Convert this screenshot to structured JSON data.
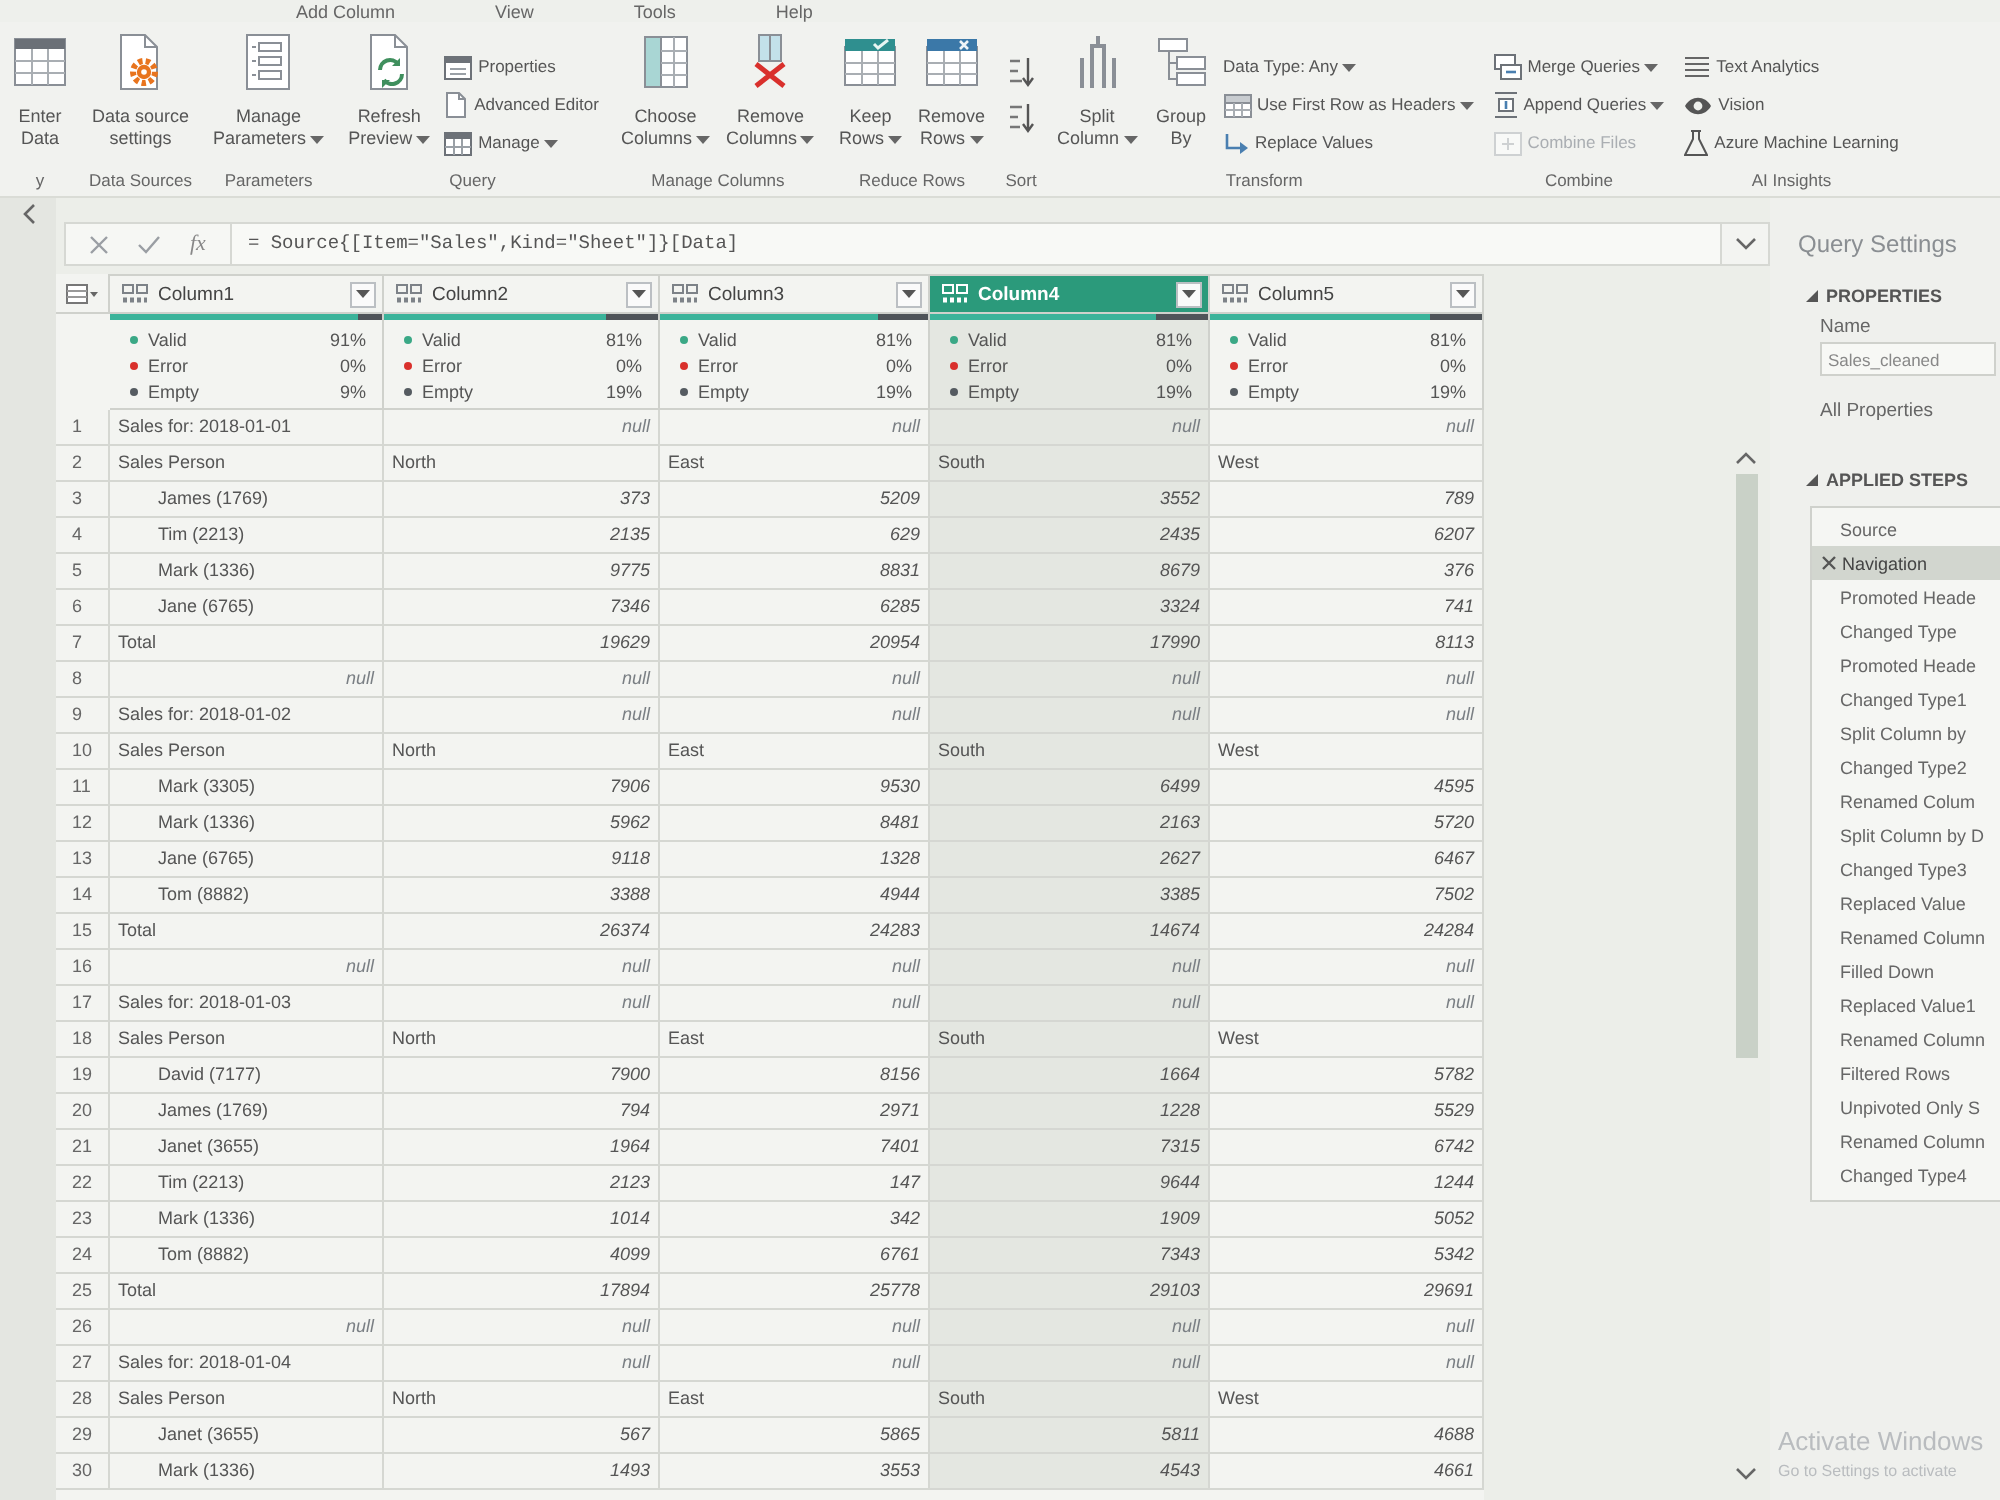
{
  "menu_tabs": [
    {
      "label": "Add Column",
      "selected": false
    },
    {
      "label": "View",
      "selected": false
    },
    {
      "label": "Tools",
      "selected": false
    },
    {
      "label": "Help",
      "selected": false
    }
  ],
  "ribbon": [
    {
      "label": "y",
      "items": [
        {
          "kind": "large",
          "lines": [
            "Enter",
            "Data"
          ],
          "dropdown": false,
          "disabled": false
        }
      ]
    },
    {
      "label": "Data Sources",
      "items": [
        {
          "kind": "large",
          "lines": [
            "Data source",
            "settings"
          ],
          "dropdown": false,
          "disabled": false
        }
      ]
    },
    {
      "label": "Parameters",
      "items": [
        {
          "kind": "large",
          "lines": [
            "Manage",
            "Parameters"
          ],
          "dropdown": true,
          "disabled": false
        }
      ]
    },
    {
      "label": "Query",
      "items": [
        {
          "kind": "large",
          "lines": [
            "Refresh",
            "Preview"
          ],
          "dropdown": true,
          "disabled": false
        },
        {
          "kind": "small",
          "lines": [
            "Properties"
          ],
          "dropdown": false,
          "disabled": false
        },
        {
          "kind": "small",
          "lines": [
            "Advanced Editor"
          ],
          "dropdown": false,
          "disabled": false
        },
        {
          "kind": "small",
          "lines": [
            "Manage"
          ],
          "dropdown": true,
          "disabled": false
        }
      ]
    },
    {
      "label": "Manage Columns",
      "items": [
        {
          "kind": "large",
          "lines": [
            "Choose",
            "Columns"
          ],
          "dropdown": true,
          "disabled": false
        },
        {
          "kind": "large",
          "lines": [
            "Remove",
            "Columns"
          ],
          "dropdown": true,
          "disabled": false
        }
      ]
    },
    {
      "label": "Reduce Rows",
      "items": [
        {
          "kind": "large",
          "lines": [
            "Keep",
            "Rows"
          ],
          "dropdown": true,
          "disabled": false
        },
        {
          "kind": "large",
          "lines": [
            "Remove",
            "Rows"
          ],
          "dropdown": true,
          "disabled": false
        }
      ]
    },
    {
      "label": "Sort",
      "items": [
        {
          "kind": "icon",
          "dropdown": false,
          "disabled": false
        },
        {
          "kind": "icon",
          "dropdown": false,
          "disabled": false
        }
      ]
    },
    {
      "label": "Transform",
      "items": [
        {
          "kind": "large",
          "lines": [
            "Split",
            "Column"
          ],
          "dropdown": true,
          "disabled": false
        },
        {
          "kind": "large",
          "lines": [
            "Group",
            "By"
          ],
          "dropdown": false,
          "disabled": false
        },
        {
          "kind": "plain",
          "lines": [
            "Data Type: Any"
          ],
          "dropdown": true,
          "disabled": false
        },
        {
          "kind": "small",
          "lines": [
            "Use First Row as Headers"
          ],
          "dropdown": true,
          "disabled": false
        },
        {
          "kind": "small",
          "lines": [
            "Replace Values"
          ],
          "dropdown": false,
          "disabled": false
        }
      ]
    },
    {
      "label": "Combine",
      "items": [
        {
          "kind": "small",
          "lines": [
            "Merge Queries"
          ],
          "dropdown": true,
          "disabled": false
        },
        {
          "kind": "small",
          "lines": [
            "Append Queries"
          ],
          "dropdown": true,
          "disabled": false
        },
        {
          "kind": "small",
          "lines": [
            "Combine Files"
          ],
          "dropdown": false,
          "disabled": true
        }
      ]
    },
    {
      "label": "AI Insights",
      "items": [
        {
          "kind": "small",
          "lines": [
            "Text Analytics"
          ],
          "dropdown": false,
          "disabled": false
        },
        {
          "kind": "small",
          "lines": [
            "Vision"
          ],
          "dropdown": false,
          "disabled": false
        },
        {
          "kind": "small",
          "lines": [
            "Azure Machine Learning"
          ],
          "dropdown": false,
          "disabled": false
        }
      ]
    }
  ],
  "formula_bar": {
    "function_label": "fx",
    "formula": "= Source{[Item=\"Sales\",Kind=\"Sheet\"]}[Data]"
  },
  "table": {
    "columns": [
      {
        "name": "Column1",
        "selected": false,
        "level": 0.91,
        "quality": [
          {
            "kind": "valid",
            "label": "Valid",
            "value": "91%"
          },
          {
            "kind": "error",
            "label": "Error",
            "value": "0%"
          },
          {
            "kind": "empty",
            "label": "Empty",
            "value": "9%"
          }
        ]
      },
      {
        "name": "Column2",
        "selected": false,
        "level": 0.81,
        "quality": [
          {
            "kind": "valid",
            "label": "Valid",
            "value": "81%"
          },
          {
            "kind": "error",
            "label": "Error",
            "value": "0%"
          },
          {
            "kind": "empty",
            "label": "Empty",
            "value": "19%"
          }
        ]
      },
      {
        "name": "Column3",
        "selected": false,
        "level": 0.81,
        "quality": [
          {
            "kind": "valid",
            "label": "Valid",
            "value": "81%"
          },
          {
            "kind": "error",
            "label": "Error",
            "value": "0%"
          },
          {
            "kind": "empty",
            "label": "Empty",
            "value": "19%"
          }
        ]
      },
      {
        "name": "Column4",
        "selected": true,
        "level": 0.81,
        "quality": [
          {
            "kind": "valid",
            "label": "Valid",
            "value": "81%"
          },
          {
            "kind": "error",
            "label": "Error",
            "value": "0%"
          },
          {
            "kind": "empty",
            "label": "Empty",
            "value": "19%"
          }
        ]
      },
      {
        "name": "Column5",
        "selected": false,
        "level": 0.81,
        "quality": [
          {
            "kind": "valid",
            "label": "Valid",
            "value": "81%"
          },
          {
            "kind": "error",
            "label": "Error",
            "value": "0%"
          },
          {
            "kind": "empty",
            "label": "Empty",
            "value": "19%"
          }
        ]
      }
    ],
    "rows": [
      {
        "number": "1",
        "kind": "date",
        "cells": [
          "Sales for: 2018-01-01",
          "null",
          "null",
          "null",
          "null"
        ]
      },
      {
        "number": "2",
        "kind": "header",
        "cells": [
          "Sales Person",
          "North",
          "East",
          "South",
          "West"
        ]
      },
      {
        "number": "3",
        "kind": "person",
        "cells": [
          "James (1769)",
          "373",
          "5209",
          "3552",
          "789"
        ]
      },
      {
        "number": "4",
        "kind": "person",
        "cells": [
          "Tim (2213)",
          "2135",
          "629",
          "2435",
          "6207"
        ]
      },
      {
        "number": "5",
        "kind": "person",
        "cells": [
          "Mark (1336)",
          "9775",
          "8831",
          "8679",
          "376"
        ]
      },
      {
        "number": "6",
        "kind": "person",
        "cells": [
          "Jane (6765)",
          "7346",
          "6285",
          "3324",
          "741"
        ]
      },
      {
        "number": "7",
        "kind": "total",
        "cells": [
          "Total",
          "19629",
          "20954",
          "17990",
          "8113"
        ]
      },
      {
        "number": "8",
        "kind": "empty",
        "cells": [
          "null",
          "null",
          "null",
          "null",
          "null"
        ]
      },
      {
        "number": "9",
        "kind": "date",
        "cells": [
          "Sales for: 2018-01-02",
          "null",
          "null",
          "null",
          "null"
        ]
      },
      {
        "number": "10",
        "kind": "header",
        "cells": [
          "Sales Person",
          "North",
          "East",
          "South",
          "West"
        ]
      },
      {
        "number": "11",
        "kind": "person",
        "cells": [
          "Mark (3305)",
          "7906",
          "9530",
          "6499",
          "4595"
        ]
      },
      {
        "number": "12",
        "kind": "person",
        "cells": [
          "Mark (1336)",
          "5962",
          "8481",
          "2163",
          "5720"
        ]
      },
      {
        "number": "13",
        "kind": "person",
        "cells": [
          "Jane (6765)",
          "9118",
          "1328",
          "2627",
          "6467"
        ]
      },
      {
        "number": "14",
        "kind": "person",
        "cells": [
          "Tom (8882)",
          "3388",
          "4944",
          "3385",
          "7502"
        ]
      },
      {
        "number": "15",
        "kind": "total",
        "cells": [
          "Total",
          "26374",
          "24283",
          "14674",
          "24284"
        ]
      },
      {
        "number": "16",
        "kind": "empty",
        "cells": [
          "null",
          "null",
          "null",
          "null",
          "null"
        ]
      },
      {
        "number": "17",
        "kind": "date",
        "cells": [
          "Sales for: 2018-01-03",
          "null",
          "null",
          "null",
          "null"
        ]
      },
      {
        "number": "18",
        "kind": "header",
        "cells": [
          "Sales Person",
          "North",
          "East",
          "South",
          "West"
        ]
      },
      {
        "number": "19",
        "kind": "person",
        "cells": [
          "David (7177)",
          "7900",
          "8156",
          "1664",
          "5782"
        ]
      },
      {
        "number": "20",
        "kind": "person",
        "cells": [
          "James (1769)",
          "794",
          "2971",
          "1228",
          "5529"
        ]
      },
      {
        "number": "21",
        "kind": "person",
        "cells": [
          "Janet (3655)",
          "1964",
          "7401",
          "7315",
          "6742"
        ]
      },
      {
        "number": "22",
        "kind": "person",
        "cells": [
          "Tim (2213)",
          "2123",
          "147",
          "9644",
          "1244"
        ]
      },
      {
        "number": "23",
        "kind": "person",
        "cells": [
          "Mark (1336)",
          "1014",
          "342",
          "1909",
          "5052"
        ]
      },
      {
        "number": "24",
        "kind": "person",
        "cells": [
          "Tom (8882)",
          "4099",
          "6761",
          "7343",
          "5342"
        ]
      },
      {
        "number": "25",
        "kind": "total",
        "cells": [
          "Total",
          "17894",
          "25778",
          "29103",
          "29691"
        ]
      },
      {
        "number": "26",
        "kind": "empty",
        "cells": [
          "null",
          "null",
          "null",
          "null",
          "null"
        ]
      },
      {
        "number": "27",
        "kind": "date",
        "cells": [
          "Sales for: 2018-01-04",
          "null",
          "null",
          "null",
          "null"
        ]
      },
      {
        "number": "28",
        "kind": "header",
        "cells": [
          "Sales Person",
          "North",
          "East",
          "South",
          "West"
        ]
      },
      {
        "number": "29",
        "kind": "person",
        "cells": [
          "Janet (3655)",
          "567",
          "5865",
          "5811",
          "4688"
        ]
      },
      {
        "number": "30",
        "kind": "person",
        "cells": [
          "Mark (1336)",
          "1493",
          "3553",
          "4543",
          "4661"
        ]
      }
    ]
  },
  "query_settings": {
    "title": "Query Settings",
    "properties": {
      "heading": "PROPERTIES",
      "expanded": true,
      "name_label": "Name",
      "name_value": "Sales_cleaned",
      "link": "All Properties"
    },
    "applied_steps": {
      "heading": "APPLIED STEPS",
      "expanded": true,
      "steps": [
        {
          "label": "Source",
          "selected": false
        },
        {
          "label": "Navigation",
          "selected": true
        },
        {
          "label": "Promoted Heade",
          "selected": false
        },
        {
          "label": "Changed Type",
          "selected": false
        },
        {
          "label": "Promoted Heade",
          "selected": false
        },
        {
          "label": "Changed Type1",
          "selected": false
        },
        {
          "label": "Split Column by",
          "selected": false
        },
        {
          "label": "Changed Type2",
          "selected": false
        },
        {
          "label": "Renamed Colum",
          "selected": false
        },
        {
          "label": "Split Column by D",
          "selected": false
        },
        {
          "label": "Changed Type3",
          "selected": false
        },
        {
          "label": "Replaced Value",
          "selected": false
        },
        {
          "label": "Renamed Column",
          "selected": false
        },
        {
          "label": "Filled Down",
          "selected": false
        },
        {
          "label": "Replaced Value1",
          "selected": false
        },
        {
          "label": "Renamed Column",
          "selected": false
        },
        {
          "label": "Filtered Rows",
          "selected": false
        },
        {
          "label": "Unpivoted Only S",
          "selected": false
        },
        {
          "label": "Renamed Column",
          "selected": false
        },
        {
          "label": "Changed Type4",
          "selected": false
        }
      ]
    }
  },
  "activation_notice": {
    "title": "Activate Windows",
    "text": "Go to Settings to activate"
  }
}
